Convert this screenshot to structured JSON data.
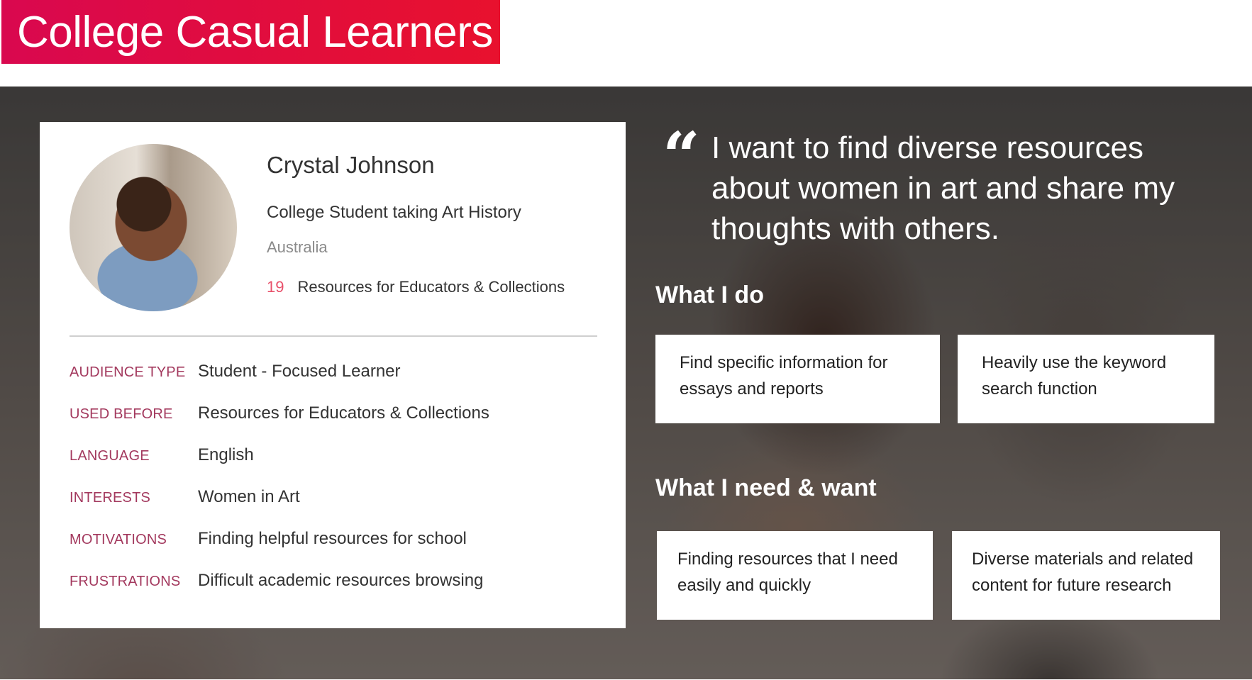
{
  "header": {
    "title": "College Casual Learners"
  },
  "profile": {
    "name": "Crystal Johnson",
    "role": "College Student taking Art History",
    "location": "Australia",
    "resources_count": "19",
    "resources_label": "Resources for Educators & Collections"
  },
  "attributes": [
    {
      "label": "Audience Type",
      "value": "Student - Focused Learner"
    },
    {
      "label": "Used Before",
      "value": "Resources for Educators & Collections"
    },
    {
      "label": "Language",
      "value": "English"
    },
    {
      "label": "Interests",
      "value": "Women in Art"
    },
    {
      "label": "Motivations",
      "value": "Finding helpful resources for school"
    },
    {
      "label": "Frustrations",
      "value": "Difficult academic resources browsing"
    }
  ],
  "quote": {
    "mark": "“",
    "text": "I want to find diverse resources about women in art and share my thoughts with others."
  },
  "what_i_do": {
    "title": "What I do",
    "items": [
      "Find specific information for essays and reports",
      "Heavily use the keyword search function"
    ]
  },
  "needs": {
    "title": "What I need & want",
    "items": [
      "Finding resources that I need easily and quickly",
      "Diverse materials and related content for future research"
    ]
  },
  "colors": {
    "header_start": "#d9084f",
    "header_end": "#e8112e",
    "label": "#a3395e",
    "count": "#e8506a"
  }
}
